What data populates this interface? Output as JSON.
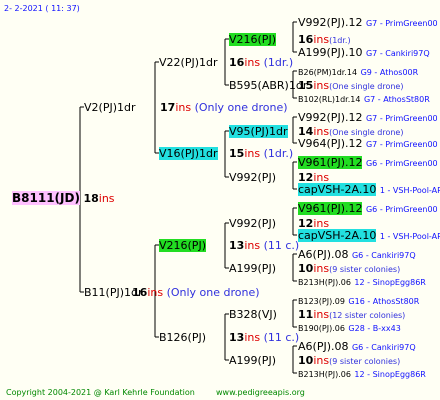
{
  "header": "2-  2-2021  ( 11:  37)",
  "footer": {
    "copyright": "Copyright 2004-2021 @ Karl Kehrle Foundation",
    "site": "www.pedigreeapis.org"
  },
  "root": {
    "name": "B8111(JD)",
    "ins": "18",
    "ins_label": "ins"
  },
  "g1": [
    {
      "name": "V2(PJ)1dr",
      "ins": "17",
      "ins_label": "ins",
      "note": "(Only one drone)"
    },
    {
      "name": "B11(PJ)1dr",
      "ins": "16",
      "ins_label": "ins",
      "note": "(Only one drone)"
    }
  ],
  "g2": [
    {
      "name": "V22(PJ)1dr",
      "ins": "16",
      "ins_label": "ins",
      "note": "(1dr.)"
    },
    {
      "name": "V16(PJ)1dr",
      "ins": "15",
      "ins_label": "ins",
      "note": "(1dr.)"
    },
    {
      "name": "V216(PJ)",
      "ins": "13",
      "ins_label": "ins",
      "note": "(11 c.)"
    },
    {
      "name": "B126(PJ)",
      "ins": "13",
      "ins_label": "ins",
      "note": "(11 c.)"
    }
  ],
  "g3": [
    {
      "name": "V216(PJ)",
      "ins": "16",
      "ins_label": "ins",
      "note": "(1dr.)"
    },
    {
      "name": "B595(ABR)1dr",
      "ins": "15",
      "ins_label": "ins",
      "note": "(One single drone)"
    },
    {
      "name": "V95(PJ)1dr",
      "ins": "14",
      "ins_label": "ins",
      "note": "(One single drone)"
    },
    {
      "name": "V992(PJ)",
      "ins": "12",
      "ins_label": "ins",
      "note": ""
    },
    {
      "name": "V992(PJ)",
      "ins": "12",
      "ins_label": "ins",
      "note": ""
    },
    {
      "name": "A199(PJ)",
      "ins": "10",
      "ins_label": "ins",
      "note": "(9 sister colonies)"
    },
    {
      "name": "B328(VJ)",
      "ins": "11",
      "ins_label": "ins",
      "note": "(12 sister colonies)"
    },
    {
      "name": "A199(PJ)",
      "ins": "10",
      "ins_label": "ins",
      "note": "(9 sister colonies)"
    }
  ],
  "g4": [
    {
      "name": "V992(PJ).12",
      "info": "G7 - PrimGreen00"
    },
    {
      "name": "A199(PJ).10",
      "info": "G7 - Cankiri97Q"
    },
    {
      "name": "B26(PM)1dr.14",
      "info": "G9 - Athos00R"
    },
    {
      "name": "B102(RL)1dr.14",
      "info": "G7 - AthosSt80R"
    },
    {
      "name": "V992(PJ).12",
      "info": "G7 - PrimGreen00"
    },
    {
      "name": "V964(PJ).12",
      "info": "G7 - PrimGreen00"
    },
    {
      "name": "V961(PJ).12",
      "info": "G6 - PrimGreen00"
    },
    {
      "name": "capVSH-2A.10",
      "info": "1 - VSH-Pool-AR"
    },
    {
      "name": "V961(PJ).12",
      "info": "G6 - PrimGreen00"
    },
    {
      "name": "capVSH-2A.10",
      "info": "1 - VSH-Pool-AR"
    },
    {
      "name": "A6(PJ).08",
      "info": "G6 - Cankiri97Q"
    },
    {
      "name": "B213H(PJ).06",
      "info": "12 - SinopEgg86R"
    },
    {
      "name": "B123(PJ).09",
      "info": "G16 - AthosSt80R"
    },
    {
      "name": "B190(PJ).06",
      "info": "G28 - B-xx43"
    },
    {
      "name": "A6(PJ).08",
      "info": "G6 - Cankiri97Q"
    },
    {
      "name": "B213H(PJ).06",
      "info": "12 - SinopEgg86R"
    }
  ],
  "colors": {
    "lines": "#000000",
    "green_hl": "#22dd22",
    "cyan_hl": "#22e0e0",
    "pink_hl": "#ffc0ff",
    "ins_red": "#dd0000",
    "note_blue": "#3030dd",
    "info_blue": "#1010ff"
  }
}
